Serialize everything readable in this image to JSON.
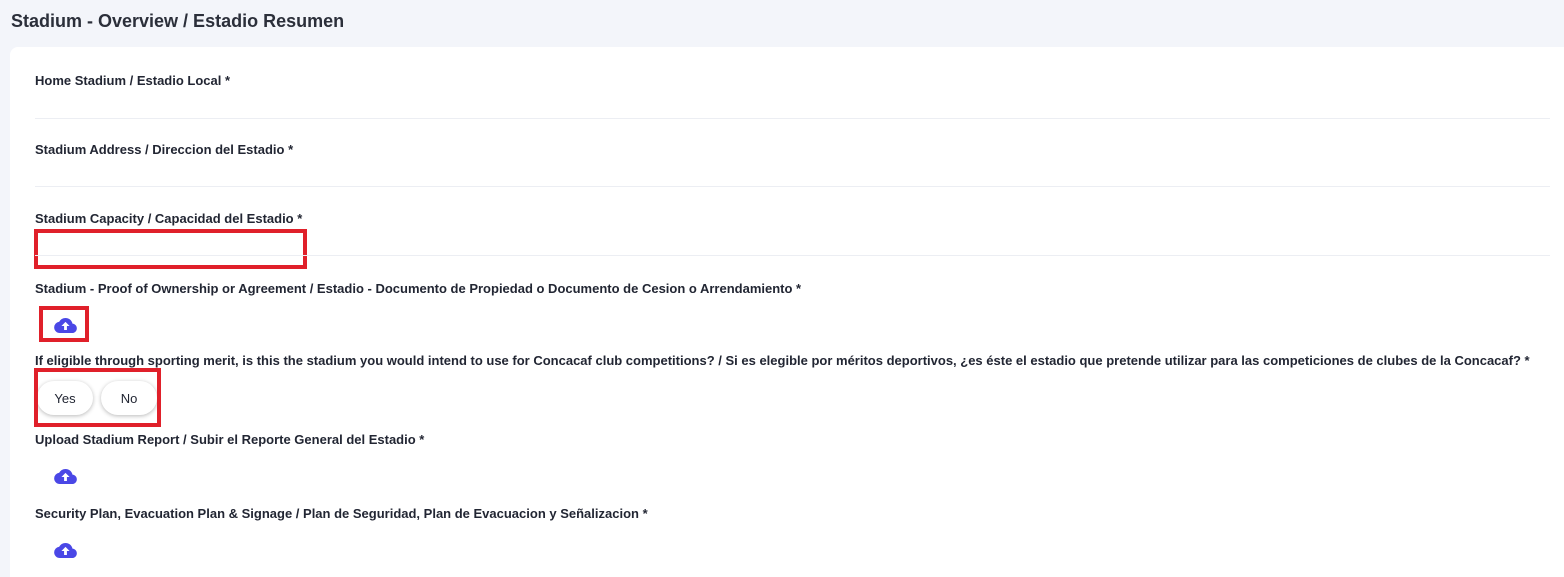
{
  "page": {
    "title": "Stadium - Overview / Estadio Resumen"
  },
  "fields": {
    "home_stadium": {
      "label": "Home Stadium / Estadio Local *"
    },
    "address": {
      "label": "Stadium Address / Direccion del Estadio *"
    },
    "capacity": {
      "label": "Stadium Capacity / Capacidad del Estadio *",
      "value": ""
    },
    "ownership": {
      "label": "Stadium - Proof of Ownership or Agreement / Estadio - Documento de Propiedad o Documento de Cesion o Arrendamiento *",
      "icon": "cloud-upload-icon"
    },
    "eligibility": {
      "label": "If eligible through sporting merit, is this the stadium you would intend to use for Concacaf club competitions? / Si es elegible por méritos deportivos, ¿es éste el estadio que pretende utilizar para las competiciones de clubes de la Concacaf? *",
      "options": [
        "Yes",
        "No"
      ]
    },
    "stadium_report": {
      "label": "Upload Stadium Report / Subir el Reporte General del Estadio *",
      "icon": "cloud-upload-icon"
    },
    "security_plan": {
      "label": "Security Plan, Evacuation Plan & Signage / Plan de Seguridad, Plan de Evacuacion y Señalizacion *",
      "icon": "cloud-upload-icon"
    }
  },
  "colors": {
    "accent": "#4a47e6",
    "highlight": "#e0202a",
    "background": "#f3f5fa",
    "card": "#ffffff",
    "text": "#222633"
  }
}
